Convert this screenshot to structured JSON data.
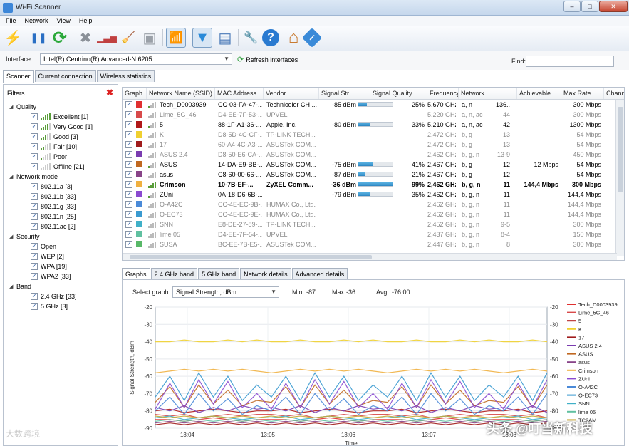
{
  "window": {
    "title": "Wi-Fi Scanner",
    "minimize": "–",
    "maximize": "□",
    "close": "✕"
  },
  "menu": [
    "File",
    "Network",
    "View",
    "Help"
  ],
  "toolbar": {
    "icons": [
      {
        "name": "scan-icon",
        "glyph": "⚡"
      },
      {
        "name": "pause-icon",
        "glyph": "❚❚"
      },
      {
        "name": "refresh-icon",
        "glyph": "⟳"
      },
      {
        "name": "delete-icon",
        "glyph": "✖"
      },
      {
        "name": "signal-bars-icon",
        "glyph": "▁▃▅"
      },
      {
        "name": "broom-icon",
        "glyph": "🧹"
      },
      {
        "name": "clear-icon",
        "glyph": "▣"
      },
      {
        "name": "signal-record-icon",
        "glyph": "📶"
      },
      {
        "name": "filter-icon",
        "glyph": "▼"
      },
      {
        "name": "panel-icon",
        "glyph": "▤"
      },
      {
        "name": "tools-icon",
        "glyph": "🔧"
      },
      {
        "name": "help-icon",
        "glyph": "?"
      },
      {
        "name": "home-icon",
        "glyph": "⌂"
      },
      {
        "name": "info-icon",
        "glyph": "i"
      }
    ]
  },
  "interface": {
    "label": "Interface:",
    "value": "Intel(R) Centrino(R) Advanced-N 6205",
    "refresh": "Refresh interfaces",
    "find_label": "Find:",
    "find_value": ""
  },
  "tabs": [
    "Scanner",
    "Current connection",
    "Wireless statistics"
  ],
  "filters": {
    "title": "Filters",
    "groups": [
      {
        "label": "Quality",
        "items": [
          "Excellent [1]",
          "Very Good [1]",
          "Good [3]",
          "Fair [10]",
          "Poor",
          "Offline [21]"
        ]
      },
      {
        "label": "Network mode",
        "items": [
          "802.11a [3]",
          "802.11b [33]",
          "802.11g [33]",
          "802.11n [25]",
          "802.11ac [2]"
        ]
      },
      {
        "label": "Security",
        "items": [
          "Open",
          "WEP [2]",
          "WPA [19]",
          "WPA2 [33]"
        ]
      },
      {
        "label": "Band",
        "items": [
          "2.4 GHz [33]",
          "5 GHz [3]"
        ]
      }
    ]
  },
  "table": {
    "columns": [
      "Graph",
      "Network Name (SSID)",
      "MAC Address...",
      "Vendor",
      "Signal Str...",
      "Signal Quality",
      "Frequency",
      "Network ...",
      "...",
      "Achievable ...",
      "Max Rate",
      "Chann"
    ],
    "rows": [
      {
        "color": "#e03030",
        "ssid": "Tech_D0003939",
        "mac": "CC-03-FA-47-...",
        "vendor": "Technicolor CH ...",
        "signal": "-85 dBm",
        "quality": "25%",
        "qv": 25,
        "freq": "5,670 GHz",
        "mode": "a, n",
        "ch": "136...",
        "ach": "",
        "max": "300 Mbps",
        "style": ""
      },
      {
        "color": "#d84a4a",
        "ssid": "Lime_5G_46",
        "mac": "D4-EE-7F-53-...",
        "vendor": "UPVEL",
        "signal": "",
        "quality": "",
        "qv": 0,
        "freq": "5,220 GHz",
        "mode": "a, n, ac",
        "ch": "44",
        "ach": "",
        "max": "300 Mbps",
        "style": "dim"
      },
      {
        "color": "#b01818",
        "ssid": "5",
        "mac": "88-1F-A1-36-...",
        "vendor": "Apple, Inc.",
        "signal": "-80 dBm",
        "quality": "33%",
        "qv": 33,
        "freq": "5,210 GHz",
        "mode": "a, n, ac",
        "ch": "42",
        "ach": "",
        "max": "1300 Mbps",
        "style": ""
      },
      {
        "color": "#f0d030",
        "ssid": "K",
        "mac": "D8-5D-4C-CF-...",
        "vendor": "TP-LINK TECH...",
        "signal": "",
        "quality": "",
        "qv": 0,
        "freq": "2,472 GHz",
        "mode": "b, g",
        "ch": "13",
        "ach": "",
        "max": "54 Mbps",
        "style": "dim"
      },
      {
        "color": "#a01c1c",
        "ssid": "17",
        "mac": "60-A4-4C-A3-...",
        "vendor": "ASUSTek COM...",
        "signal": "",
        "quality": "",
        "qv": 0,
        "freq": "2,472 GHz",
        "mode": "b, g",
        "ch": "13",
        "ach": "",
        "max": "54 Mbps",
        "style": "dim"
      },
      {
        "color": "#7a3cb0",
        "ssid": "ASUS 2.4",
        "mac": "D8-50-E6-CA-...",
        "vendor": "ASUSTek COM...",
        "signal": "",
        "quality": "",
        "qv": 0,
        "freq": "2,462 GHz",
        "mode": "b, g, n",
        "ch": "13-9",
        "ach": "",
        "max": "450 Mbps",
        "style": "dim"
      },
      {
        "color": "#c06820",
        "ssid": "ASUS",
        "mac": "14-DA-E9-BB-...",
        "vendor": "ASUSTek COM...",
        "signal": "-75 dBm",
        "quality": "41%",
        "qv": 41,
        "freq": "2,467 GHz",
        "mode": "b, g",
        "ch": "12",
        "ach": "12 Mbps",
        "max": "54 Mbps",
        "style": ""
      },
      {
        "color": "#884488",
        "ssid": "asus",
        "mac": "C8-60-00-66-...",
        "vendor": "ASUSTek COM...",
        "signal": "-87 dBm",
        "quality": "21%",
        "qv": 21,
        "freq": "2,467 GHz",
        "mode": "b, g",
        "ch": "12",
        "ach": "",
        "max": "54 Mbps",
        "style": ""
      },
      {
        "color": "#f0b040",
        "ssid": "Crimson",
        "mac": "10-7B-EF-...",
        "vendor": "ZyXEL Comm...",
        "signal": "-36 dBm",
        "quality": "99%",
        "qv": 99,
        "freq": "2,462 GHz",
        "mode": "b, g, n",
        "ch": "11",
        "ach": "144,4 Mbps",
        "max": "300 Mbps",
        "style": "bold"
      },
      {
        "color": "#8a4ad0",
        "ssid": "ZUni",
        "mac": "0A-18-D6-6B-...",
        "vendor": "",
        "signal": "-79 dBm",
        "quality": "35%",
        "qv": 35,
        "freq": "2,462 GHz",
        "mode": "b, g, n",
        "ch": "11",
        "ach": "",
        "max": "144,4 Mbps",
        "style": ""
      },
      {
        "color": "#4a8ad8",
        "ssid": "O-A42C",
        "mac": "CC-4E-EC-9B-...",
        "vendor": "HUMAX Co., Ltd.",
        "signal": "",
        "quality": "",
        "qv": 0,
        "freq": "2,462 GHz",
        "mode": "b, g, n",
        "ch": "11",
        "ach": "",
        "max": "144,4 Mbps",
        "style": "dim"
      },
      {
        "color": "#3a9ad0",
        "ssid": "O-EC73",
        "mac": "CC-4E-EC-9E-...",
        "vendor": "HUMAX Co., Ltd.",
        "signal": "",
        "quality": "",
        "qv": 0,
        "freq": "2,462 GHz",
        "mode": "b, g, n",
        "ch": "11",
        "ach": "",
        "max": "144,4 Mbps",
        "style": "dim"
      },
      {
        "color": "#40b0c8",
        "ssid": "SNN",
        "mac": "E8-DE-27-89-...",
        "vendor": "TP-LINK TECH...",
        "signal": "",
        "quality": "",
        "qv": 0,
        "freq": "2,452 GHz",
        "mode": "b, g, n",
        "ch": "9-5",
        "ach": "",
        "max": "300 Mbps",
        "style": "dim"
      },
      {
        "color": "#60c0a0",
        "ssid": "lime 05",
        "mac": "D4-EE-7F-54-...",
        "vendor": "UPVEL",
        "signal": "",
        "quality": "",
        "qv": 0,
        "freq": "2,437 GHz",
        "mode": "b, g, n",
        "ch": "8-4",
        "ach": "",
        "max": "150 Mbps",
        "style": "dim"
      },
      {
        "color": "#58b868",
        "ssid": "SUSA",
        "mac": "BC-EE-7B-E5-...",
        "vendor": "ASUSTek COM...",
        "signal": "",
        "quality": "",
        "qv": 0,
        "freq": "2,447 GHz",
        "mode": "b, g, n",
        "ch": "8",
        "ach": "",
        "max": "300 Mbps",
        "style": "dim"
      }
    ]
  },
  "graph_tabs": [
    "Graphs",
    "2.4 GHz band",
    "5 GHz band",
    "Network details",
    "Advanced details"
  ],
  "graph": {
    "select_label": "Select graph:",
    "select_value": "Signal Strength, dBm",
    "min_label": "Min:",
    "min_value": "-87",
    "max_label": "Max:",
    "max_value": "-36",
    "avg_label": "Avg:",
    "avg_value": "-76,00",
    "legend_colors": [
      "#e03030",
      "#d84a4a",
      "#b01818",
      "#f0d030",
      "#a01c1c",
      "#7a3cb0",
      "#c06820",
      "#884488",
      "#f0b040",
      "#8a4ad0",
      "#4a8ad8",
      "#3a9ad0",
      "#40b0c8",
      "#60c0a0",
      "#c8a838"
    ]
  },
  "chart_data": {
    "type": "line",
    "xlabel": "Time",
    "ylabel": "Signal Strength, dBm",
    "ylim": [
      -90,
      -20
    ],
    "yticks": [
      -20,
      -30,
      -40,
      -50,
      -60,
      -70,
      -80,
      -90
    ],
    "xticks": [
      "13:04",
      "13:05",
      "13:06",
      "13:07",
      "13:08"
    ],
    "grid": true,
    "legend_placement": "right",
    "series": [
      {
        "name": "Tech_D0003939",
        "values": [
          -85,
          -85,
          -86,
          -85,
          -84,
          -85,
          -86,
          -85
        ]
      },
      {
        "name": "Lime_5G_46",
        "values": [
          -82,
          -83,
          -82,
          -84,
          -83,
          -82,
          -83,
          -82
        ]
      },
      {
        "name": "5",
        "values": [
          -80,
          -79,
          -81,
          -80,
          -79,
          -80,
          -81,
          -80
        ]
      },
      {
        "name": "K",
        "values": [
          -40,
          -40,
          -39,
          -40,
          -40,
          -39,
          -40,
          -39
        ]
      },
      {
        "name": "17",
        "values": [
          -88,
          -87,
          -88,
          -87,
          -88,
          -87,
          -88,
          -87
        ]
      },
      {
        "name": "ASUS 2.4",
        "values": [
          -78,
          -80,
          -77,
          -81,
          -78,
          -80,
          -77,
          -79
        ]
      },
      {
        "name": "ASUS",
        "values": [
          -75,
          -66,
          -78,
          -65,
          -76,
          -68,
          -77,
          -74
        ]
      },
      {
        "name": "asus",
        "values": [
          -87,
          -86,
          -87,
          -86,
          -87,
          -86,
          -87,
          -86
        ]
      },
      {
        "name": "Crimson",
        "values": [
          -58,
          -57,
          -56,
          -57,
          -56,
          -57,
          -56,
          -57
        ]
      },
      {
        "name": "ZUni",
        "values": [
          -79,
          -64,
          -78,
          -62,
          -76,
          -63,
          -78,
          -70
        ]
      },
      {
        "name": "O-A42C",
        "values": [
          -80,
          -72,
          -82,
          -70,
          -80,
          -73,
          -82,
          -77
        ]
      },
      {
        "name": "O-EC73",
        "values": [
          -72,
          -60,
          -74,
          -58,
          -72,
          -60,
          -74,
          -65
        ]
      },
      {
        "name": "SNN",
        "values": [
          -84,
          -83,
          -85,
          -84,
          -83,
          -84,
          -85,
          -84
        ]
      },
      {
        "name": "lime 05",
        "values": [
          -86,
          -85,
          -86,
          -85,
          -86,
          -85,
          -86,
          -85
        ]
      },
      {
        "name": "TC2AM",
        "values": [
          -83,
          -84,
          -83,
          -84,
          -83,
          -84,
          -83,
          -84
        ]
      }
    ]
  },
  "legend": [
    "Tech_D0003939",
    "Lime_5G_46",
    "5",
    "K",
    "17",
    "ASUS 2.4",
    "ASUS",
    "asus",
    "Crimson",
    "ZUni",
    "O-A42C",
    "O-EC73",
    "SNN",
    "lime 05",
    "TC2AM"
  ],
  "watermarks": {
    "left": "大数跨境",
    "right": "头条 @叮当新科技"
  }
}
